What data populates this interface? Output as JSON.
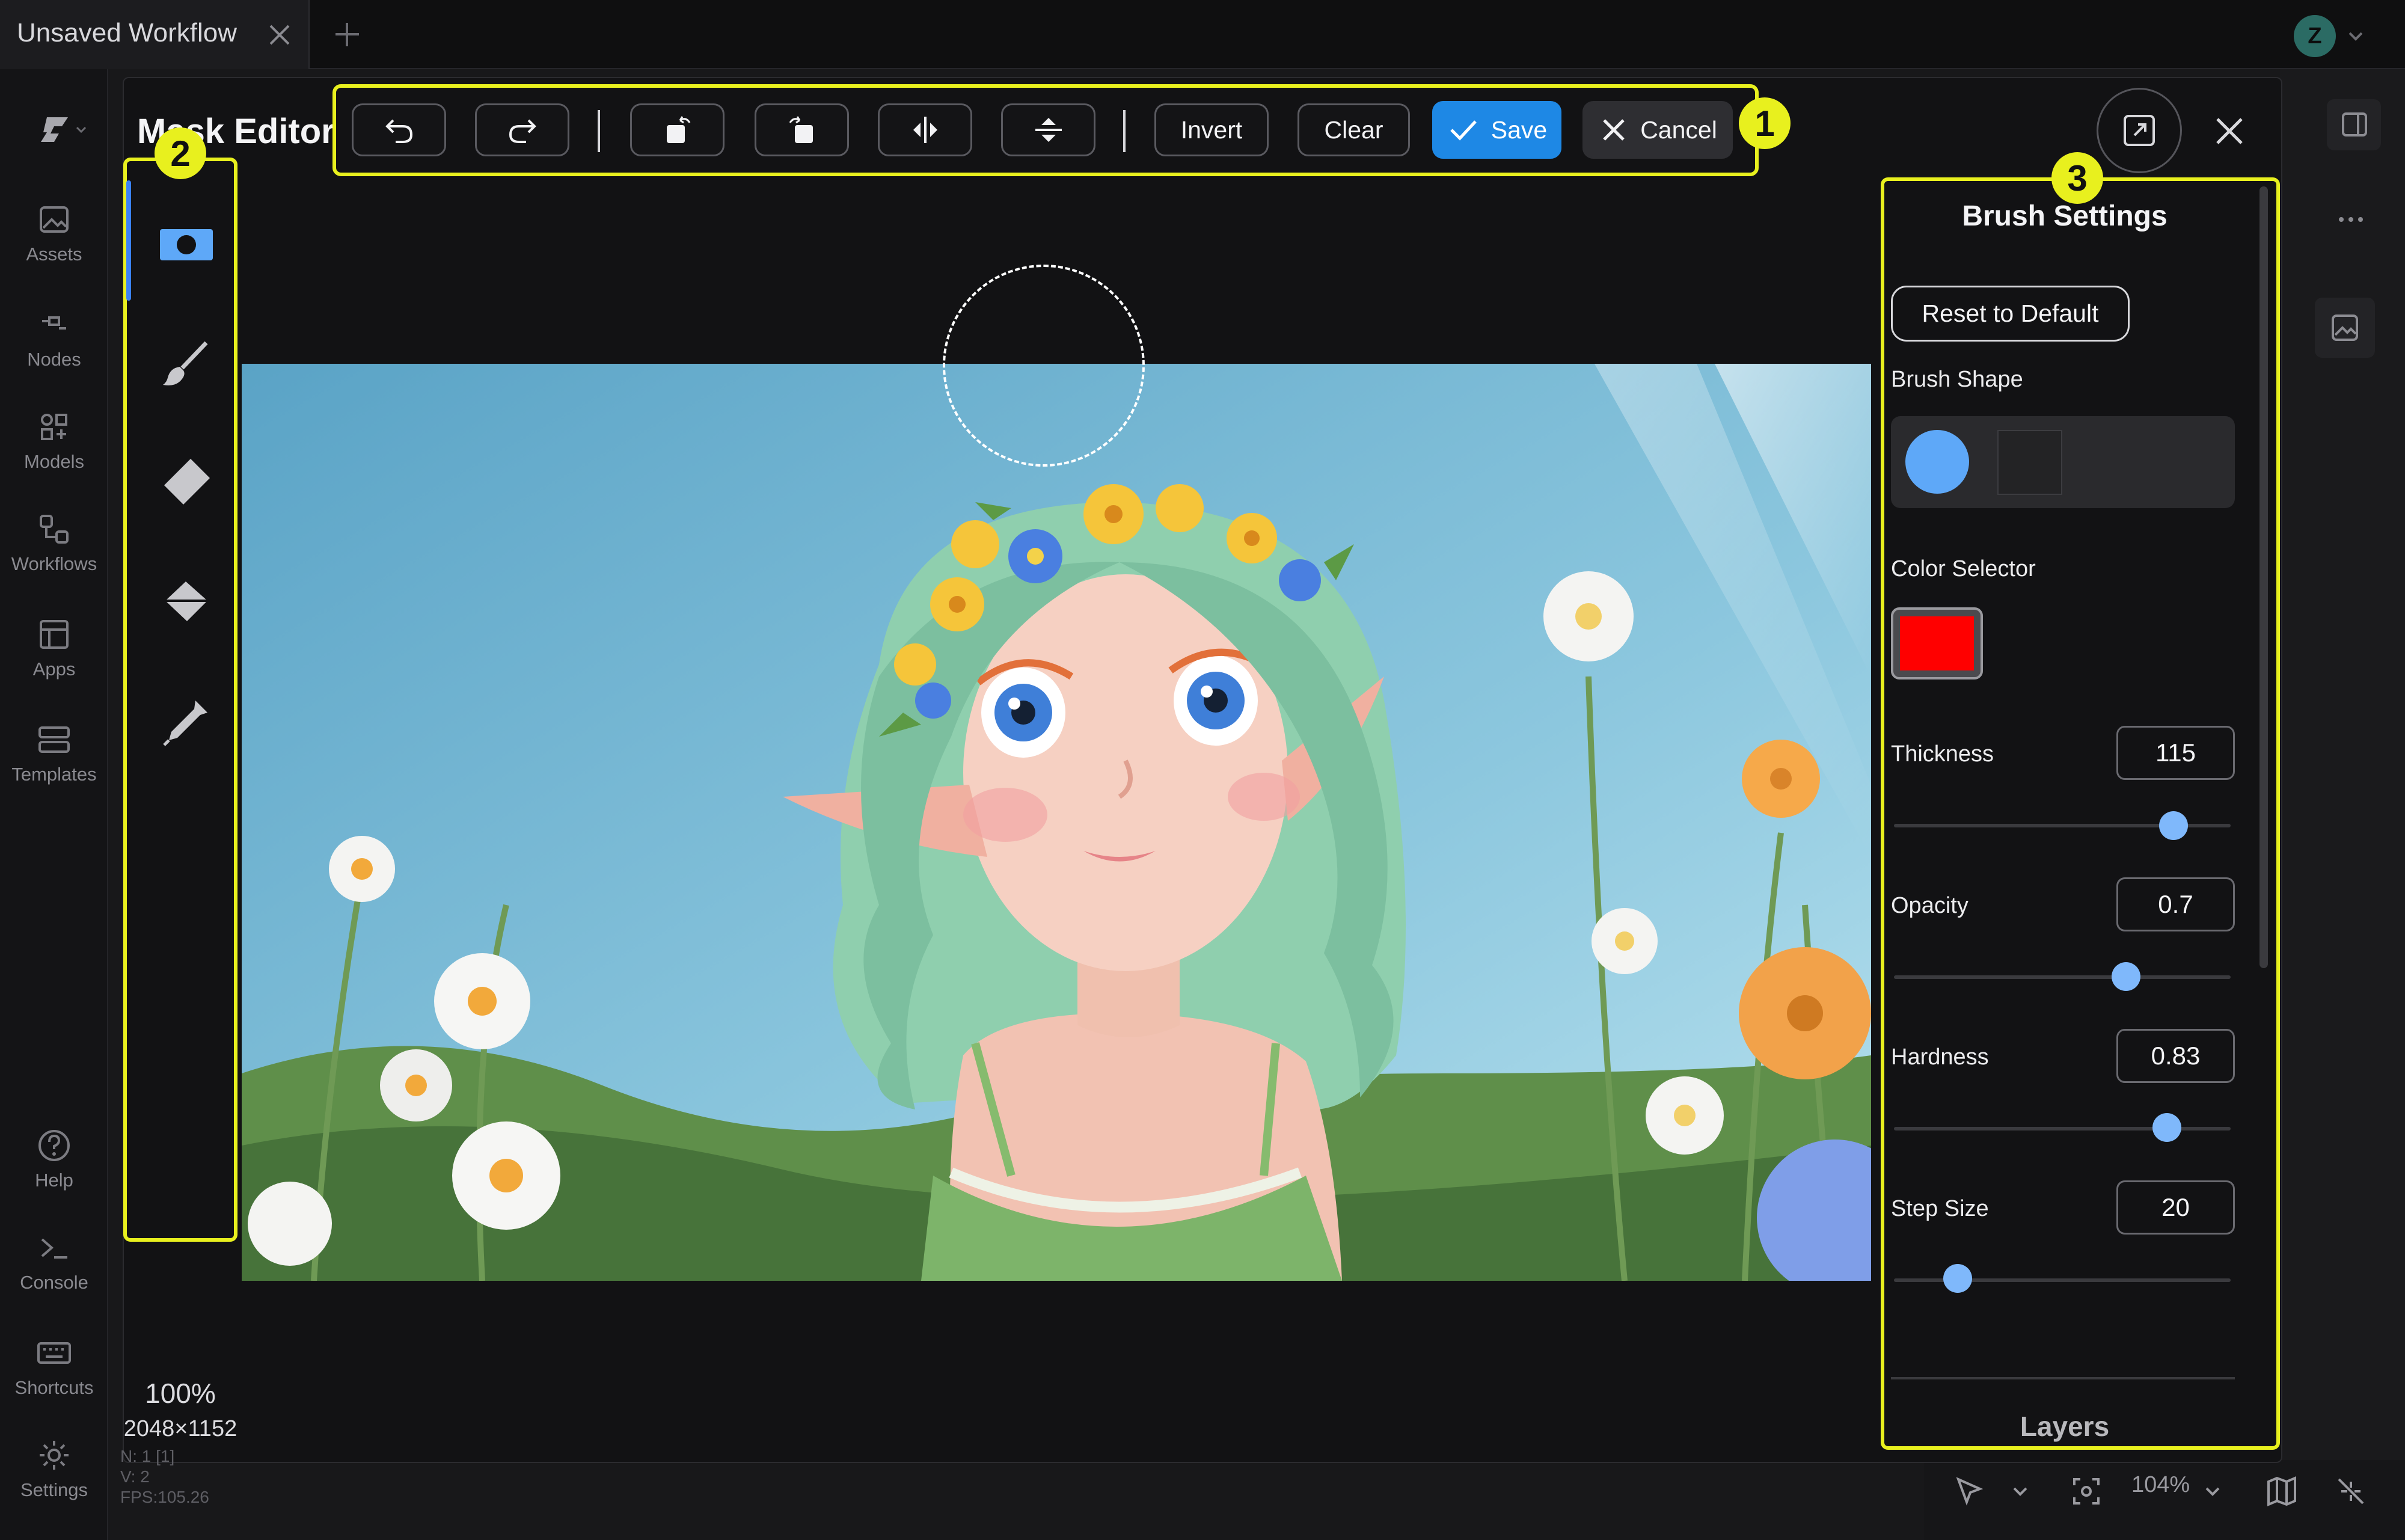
{
  "tab": {
    "title": "Unsaved Workflow"
  },
  "user": {
    "initial": "Z"
  },
  "sidebar": {
    "items": [
      {
        "label": "Assets",
        "icon": "image-icon"
      },
      {
        "label": "Nodes",
        "icon": "node-icon"
      },
      {
        "label": "Models",
        "icon": "model-icon"
      },
      {
        "label": "Workflows",
        "icon": "workflow-icon"
      },
      {
        "label": "Apps",
        "icon": "app-icon"
      },
      {
        "label": "Templates",
        "icon": "templates-icon"
      },
      {
        "label": "Help",
        "icon": "help-icon"
      },
      {
        "label": "Console",
        "icon": "console-icon"
      },
      {
        "label": "Shortcuts",
        "icon": "keyboard-icon"
      },
      {
        "label": "Settings",
        "icon": "gear-icon"
      }
    ]
  },
  "editor": {
    "title": "Mask Editor",
    "toolbar": {
      "invert_label": "Invert",
      "clear_label": "Clear",
      "save_label": "Save",
      "cancel_label": "Cancel"
    },
    "badges": [
      "1",
      "2",
      "3"
    ],
    "zoom": "100%",
    "dimensions": "2048×1152",
    "debug": [
      "N: 1 [1]",
      "V: 2",
      "FPS:105.26"
    ]
  },
  "brush_settings": {
    "title": "Brush Settings",
    "reset_label": "Reset to Default",
    "shape_label": "Brush Shape",
    "color_label": "Color Selector",
    "color": "#ff0000",
    "thickness_label": "Thickness",
    "thickness": "115",
    "thickness_fraction": 0.83,
    "opacity_label": "Opacity",
    "opacity": "0.7",
    "opacity_fraction": 0.69,
    "hardness_label": "Hardness",
    "hardness": "0.83",
    "hardness_fraction": 0.81,
    "step_label": "Step Size",
    "step": "20",
    "step_fraction": 0.19,
    "layers_label": "Layers"
  },
  "status": {
    "zoom": "104%"
  },
  "colors": {
    "accent": "#1e88e5",
    "highlight": "#e8f01e",
    "slider": "#7fb8fb"
  }
}
